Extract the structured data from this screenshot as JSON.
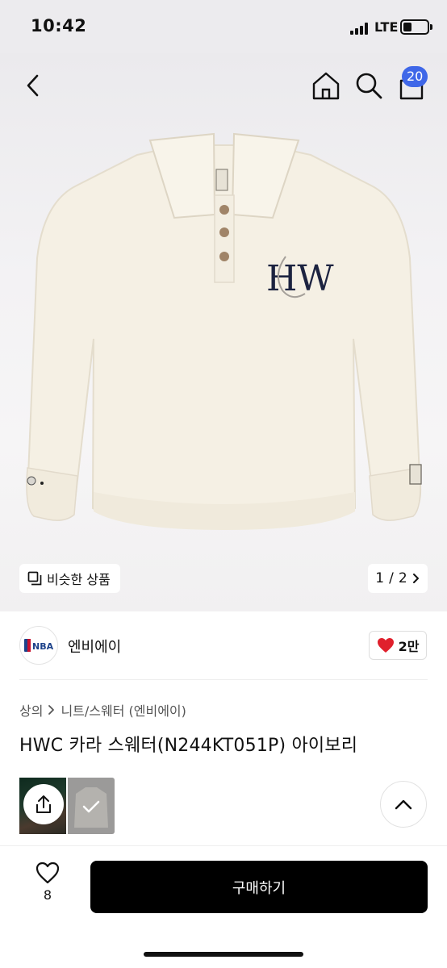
{
  "status_bar": {
    "time": "10:42",
    "network": "LTE"
  },
  "header": {
    "cart_count": "20"
  },
  "gallery": {
    "similar_label": "비슷한 상품",
    "page_current": "1",
    "page_separator": "/",
    "page_total": "2",
    "logo_text": "HW"
  },
  "brand": {
    "logo": "NBA",
    "name": "엔비에이",
    "likes": "2만"
  },
  "breadcrumb": {
    "level1": "상의",
    "level2": "니트/스웨터 (엔비에이)"
  },
  "product": {
    "title": "HWC 카라 스웨터(N244KT051P) 아이보리"
  },
  "bottom": {
    "wish_count": "8",
    "buy_label": "구매하기"
  },
  "colors": {
    "accent": "#3f67e8",
    "heart": "#e0202c",
    "buy_button": "#000000"
  }
}
